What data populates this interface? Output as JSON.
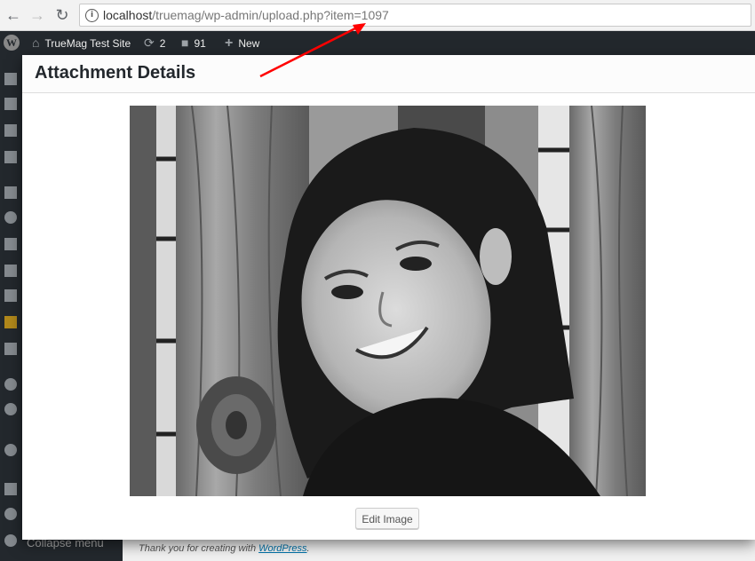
{
  "browser": {
    "url_host": "localhost",
    "url_path": "/truemag/wp-admin/upload.php?item=1097",
    "back_icon": "arrow-left-icon",
    "forward_icon": "arrow-right-icon",
    "reload_icon": "reload-icon",
    "info_icon": "info-icon"
  },
  "admin_bar": {
    "site_name": "TrueMag Test Site",
    "updates_count": "2",
    "comments_count": "91",
    "new_label": "New"
  },
  "modal": {
    "title": "Attachment Details",
    "edit_button": "Edit Image",
    "image_description": "Black and white photo of smiling girl in front of wooden fence"
  },
  "footer": {
    "text": "Thank you for creating with ",
    "link": "WordPress",
    "period": ".",
    "collapse_label": "Collapse menu"
  },
  "annotation": {
    "arrow_color": "#ff0000"
  }
}
